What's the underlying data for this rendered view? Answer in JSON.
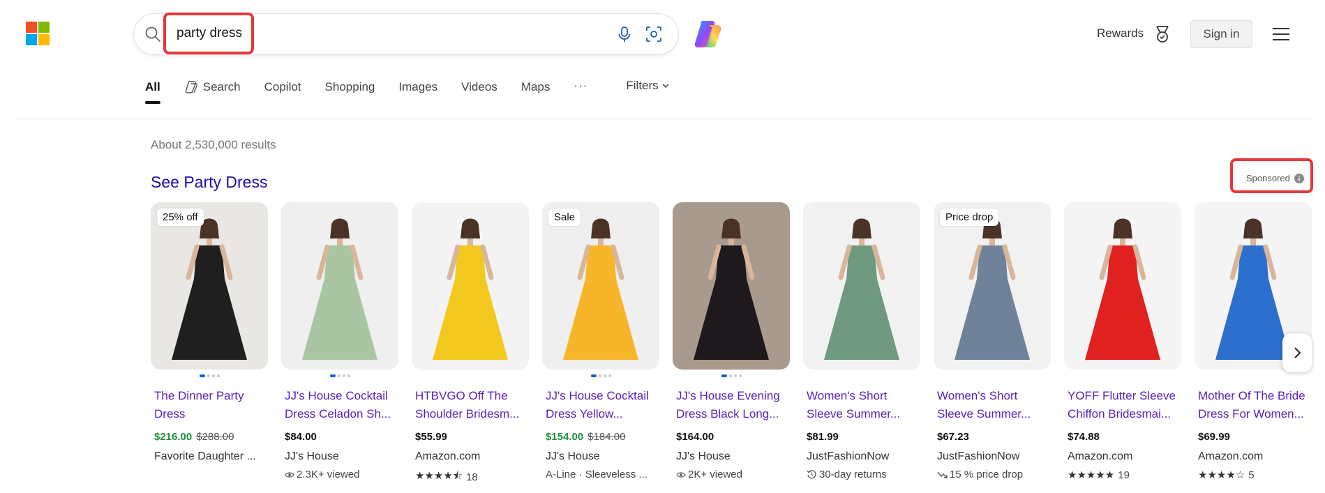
{
  "header": {
    "logo_colors": [
      "#f25022",
      "#7fba00",
      "#00a4ef",
      "#ffb900"
    ],
    "search": {
      "query": "party dress"
    },
    "rewards_label": "Rewards",
    "signin_label": "Sign in"
  },
  "tabs": [
    {
      "label": "All",
      "active": true
    },
    {
      "label": "Search",
      "icon": "copilot-search-icon"
    },
    {
      "label": "Copilot"
    },
    {
      "label": "Shopping"
    },
    {
      "label": "Images"
    },
    {
      "label": "Videos"
    },
    {
      "label": "Maps"
    }
  ],
  "more_label": "···",
  "filters_label": "Filters",
  "results_count": "About 2,530,000 results",
  "section_title": "See Party Dress",
  "sponsored_label": "Sponsored",
  "products": [
    {
      "title1": "The Dinner Party",
      "title2": "Dress",
      "price": "$216.00",
      "old_price": "$288.00",
      "sale": true,
      "seller": "Favorite Daughter ...",
      "badge": "25% off",
      "meta": "",
      "meta_icon": "",
      "dots": 4,
      "dress_color": "#1f1f1f",
      "bg": "#e9e7e3"
    },
    {
      "title1": "JJ's House Cocktail",
      "title2": "Dress Celadon Sh...",
      "price": "$84.00",
      "old_price": "",
      "sale": false,
      "seller": "JJ's House",
      "badge": "",
      "meta": "2.3K+ viewed",
      "meta_icon": "eye-icon",
      "dots": 4,
      "dress_color": "#a9c6a2",
      "bg": "#efefef"
    },
    {
      "title1": "HTBVGO Off The",
      "title2": "Shoulder Bridesm...",
      "price": "$55.99",
      "old_price": "",
      "sale": false,
      "seller": "Amazon.com",
      "badge": "",
      "meta": "18",
      "stars": "★★★★⯪",
      "meta_icon": "",
      "dots": 0,
      "dress_color": "#f2c81e",
      "bg": "#f3f3f3"
    },
    {
      "title1": "JJ's House Cocktail",
      "title2": "Dress Yellow...",
      "price": "$154.00",
      "old_price": "$184.00",
      "sale": true,
      "seller": "JJ's House",
      "badge": "Sale",
      "meta": "A-Line · Sleeveless ...",
      "meta_icon": "",
      "dots": 4,
      "dress_color": "#f7b52a",
      "bg": "#efefef"
    },
    {
      "title1": "JJ's House Evening",
      "title2": "Dress Black Long...",
      "price": "$164.00",
      "old_price": "",
      "sale": false,
      "seller": "JJ's House",
      "badge": "",
      "meta": "2K+ viewed",
      "meta_icon": "eye-icon",
      "dots": 4,
      "dress_color": "#1c1a1c",
      "bg": "#a89a8c"
    },
    {
      "title1": "Women's Short",
      "title2": "Sleeve Summer...",
      "price": "$81.99",
      "old_price": "",
      "sale": false,
      "seller": "JustFashionNow",
      "badge": "",
      "meta": "30-day returns",
      "meta_icon": "returns-icon",
      "dots": 0,
      "dress_color": "#6f9a80",
      "bg": "#f1f1f1"
    },
    {
      "title1": "Women's Short",
      "title2": "Sleeve Summer...",
      "price": "$67.23",
      "old_price": "",
      "sale": false,
      "seller": "JustFashionNow",
      "badge": "Price drop",
      "meta": "15 % price drop",
      "meta_icon": "price-drop-icon",
      "dots": 0,
      "dress_color": "#6e8299",
      "bg": "#f1f1f1"
    },
    {
      "title1": "YOFF Flutter Sleeve",
      "title2": "Chiffon Bridesmai...",
      "price": "$74.88",
      "old_price": "",
      "sale": false,
      "seller": "Amazon.com",
      "badge": "",
      "meta": "19",
      "stars": "★★★★★",
      "meta_icon": "",
      "dots": 0,
      "dress_color": "#e0211f",
      "bg": "#f4f4f4"
    },
    {
      "title1": "Mother Of The Bride",
      "title2": "Dress For Women...",
      "price": "$69.99",
      "old_price": "",
      "sale": false,
      "seller": "Amazon.com",
      "badge": "",
      "meta": "5",
      "stars": "★★★★☆",
      "meta_icon": "",
      "dots": 0,
      "dress_color": "#2d6fcf",
      "bg": "#f4f4f4"
    }
  ]
}
